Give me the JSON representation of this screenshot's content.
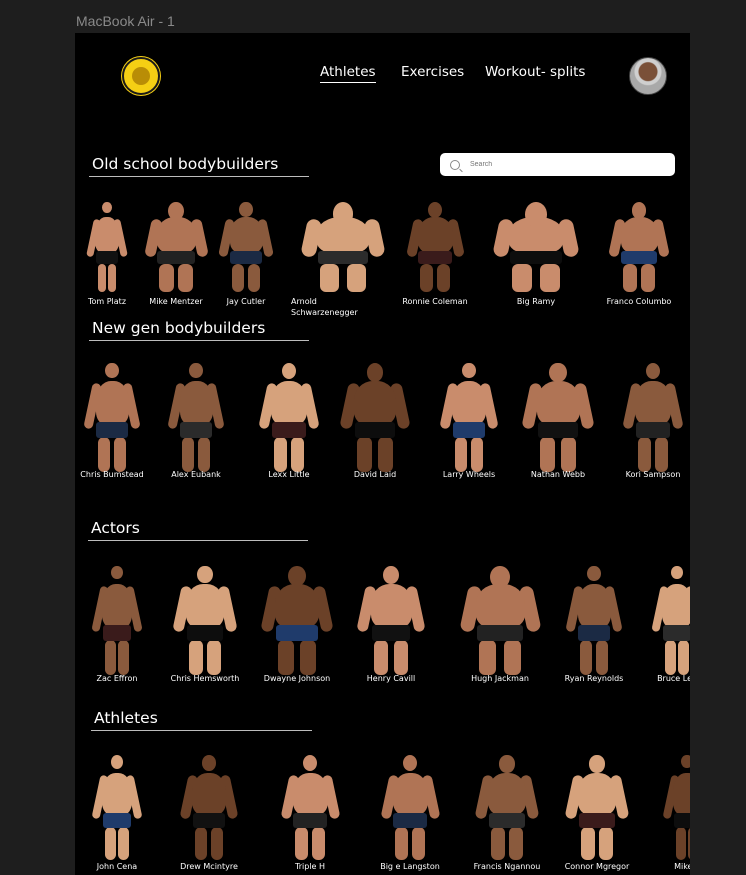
{
  "frame_label": "MacBook Air - 1",
  "nav": {
    "links": [
      {
        "label": "Athletes",
        "active": true
      },
      {
        "label": "Exercises",
        "active": false
      },
      {
        "label": "Workout- splits",
        "active": false
      }
    ]
  },
  "search": {
    "placeholder": "Search"
  },
  "sections": {
    "old_school": {
      "title": "Old school bodybuilders",
      "items": [
        "Tom Platz",
        "Mike Mentzer",
        "Jay Cutler",
        "Arnold Schwarzenegger",
        "Ronnie Coleman",
        "Big Ramy",
        "Franco Columbo"
      ]
    },
    "new_gen": {
      "title": "New gen bodybuilders",
      "items": [
        "Chris Bumstead",
        "Alex Eubank",
        "Lexx Little",
        "David Laid",
        "Larry Wheels",
        "Nathan Webb",
        "Kori Sampson"
      ]
    },
    "actors": {
      "title": "Actors",
      "items": [
        "Zac Effron",
        "Chris Hemsworth",
        "Dwayne Johnson",
        "Henry Cavill",
        "Hugh Jackman",
        "Ryan Reynolds",
        "Bruce Lee"
      ]
    },
    "athletes": {
      "title": "Athletes",
      "items": [
        "John Cena",
        "Drew Mcintyre",
        "Triple H",
        "Big e Langston",
        "Francis Ngannou",
        "Connor Mgregor",
        "Mike T"
      ]
    }
  },
  "colors": {
    "logo": "#f5cf14",
    "skin": [
      "#c98c6c",
      "#b07455",
      "#8a5a3d",
      "#d6a27c",
      "#6b4128"
    ]
  }
}
